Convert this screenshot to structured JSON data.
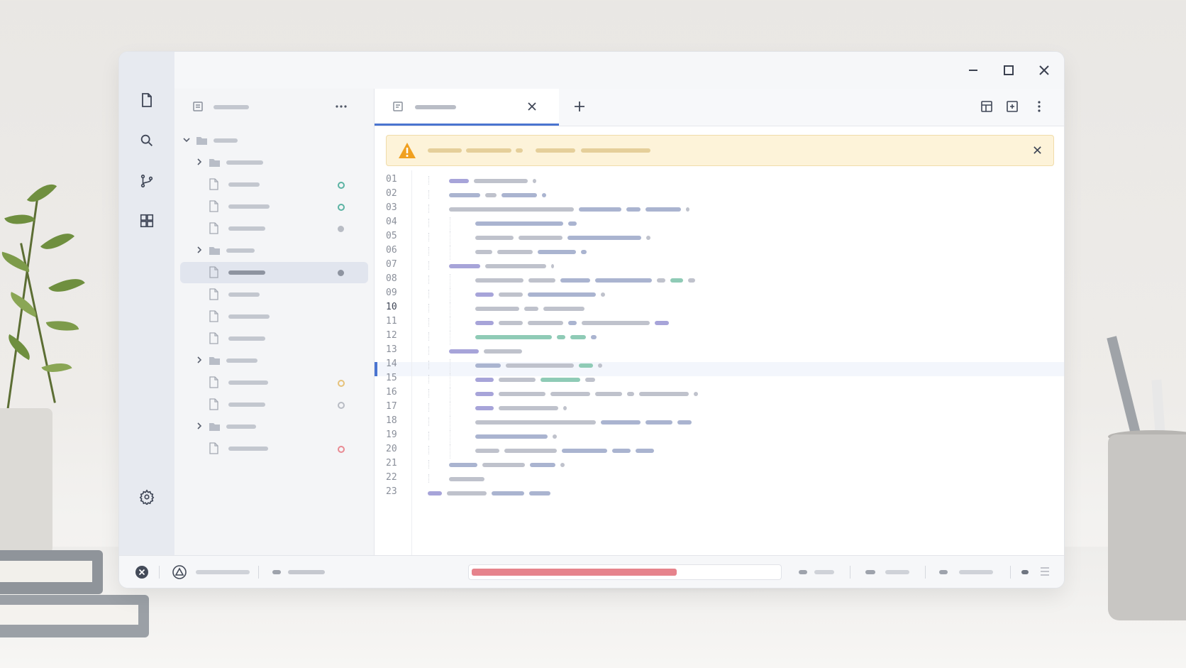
{
  "colors": {
    "accent": "#4a74d0",
    "warning": "#f0a020",
    "status_new": "#5bb3a3",
    "status_modified": "#e6c27a",
    "status_error": "#e98a93",
    "status_muted": "#b8bcc4",
    "progress": "#e6838c"
  },
  "window_controls": [
    "minimize-icon",
    "maximize-icon",
    "close-icon"
  ],
  "activity_bar": [
    "files-icon",
    "search-icon",
    "source-control-icon",
    "extensions-icon",
    "settings-icon"
  ],
  "explorer": {
    "header_icon": "explorer-panel-icon",
    "more_icon": "more-horizontal-icon",
    "tree": [
      {
        "type": "folder",
        "depth": 0,
        "expanded": true,
        "status": null
      },
      {
        "type": "folder",
        "depth": 1,
        "expanded": false,
        "status": null
      },
      {
        "type": "file",
        "depth": 2,
        "status": "new"
      },
      {
        "type": "file",
        "depth": 2,
        "status": "new"
      },
      {
        "type": "file",
        "depth": 2,
        "status": "muted"
      },
      {
        "type": "folder",
        "depth": 1,
        "expanded": false,
        "status": null
      },
      {
        "type": "file",
        "depth": 2,
        "status": "muted",
        "selected": true
      },
      {
        "type": "file",
        "depth": 2,
        "status": null
      },
      {
        "type": "file",
        "depth": 2,
        "status": null
      },
      {
        "type": "file",
        "depth": 2,
        "status": null
      },
      {
        "type": "folder",
        "depth": 1,
        "expanded": false,
        "status": null
      },
      {
        "type": "file",
        "depth": 2,
        "status": "modified"
      },
      {
        "type": "file",
        "depth": 2,
        "status": "muted"
      },
      {
        "type": "folder",
        "depth": 1,
        "expanded": false,
        "status": null
      },
      {
        "type": "file",
        "depth": 2,
        "status": "error"
      }
    ]
  },
  "editor": {
    "tab_icon": "file-tab-icon",
    "tab_close_icon": "close-icon",
    "new_tab_icon": "plus-icon",
    "toolbar_icons": [
      "layout-icon",
      "split-editor-icon",
      "more-vertical-icon"
    ],
    "banner": {
      "icon": "warning-icon",
      "close_icon": "close-icon"
    },
    "line_numbers": [
      "01",
      "02",
      "03",
      "04",
      "05",
      "06",
      "07",
      "08",
      "09",
      "10",
      "11",
      "12",
      "13",
      "14",
      "15",
      "16",
      "17",
      "18",
      "19",
      "20",
      "21",
      "22",
      "23"
    ],
    "current_line": 10
  },
  "statusbar": {
    "error_icon": "error-circle-icon",
    "warning_icon": "warning-triangle-icon",
    "progress": 0.7
  }
}
